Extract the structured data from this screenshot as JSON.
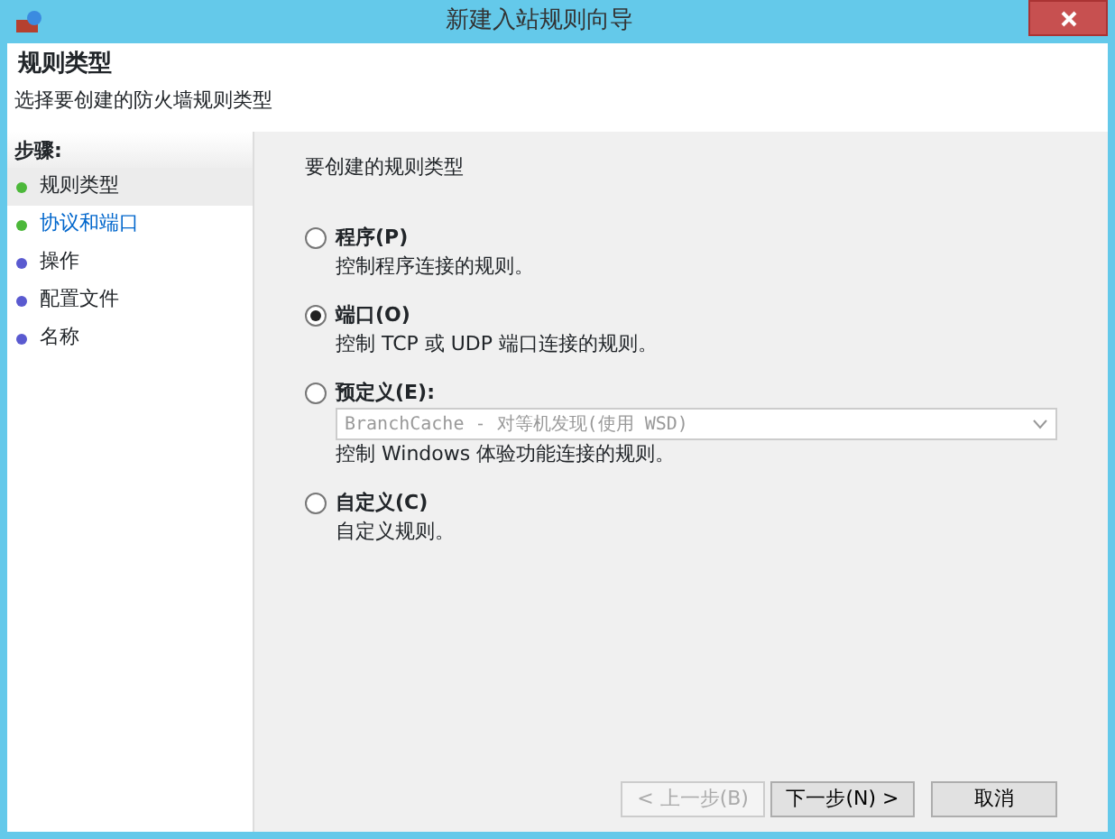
{
  "window": {
    "title": "新建入站规则向导"
  },
  "header": {
    "title": "规则类型",
    "subtitle": "选择要创建的防火墙规则类型"
  },
  "sidebar": {
    "title": "步骤:",
    "items": [
      {
        "label": "规则类型",
        "color": "#4cb83a",
        "selected": true,
        "kind": "step"
      },
      {
        "label": "协议和端口",
        "color": "#4cb83a",
        "selected": false,
        "kind": "link"
      },
      {
        "label": "操作",
        "color": "#5a5ad0",
        "selected": false,
        "kind": "step"
      },
      {
        "label": "配置文件",
        "color": "#5a5ad0",
        "selected": false,
        "kind": "step"
      },
      {
        "label": "名称",
        "color": "#5a5ad0",
        "selected": false,
        "kind": "step"
      }
    ]
  },
  "content": {
    "prompt": "要创建的规则类型",
    "options": [
      {
        "label": "程序(P)",
        "description": "控制程序连接的规则。",
        "selected": false,
        "kind": "radio"
      },
      {
        "label": "端口(O)",
        "description": "控制 TCP 或 UDP 端口连接的规则。",
        "selected": true,
        "kind": "radio"
      },
      {
        "label": "预定义(E):",
        "description": "控制 Windows 体验功能连接的规则。",
        "selected": false,
        "kind": "dropdown",
        "dropdown": {
          "value": "BranchCache - 对等机发现(使用 WSD)",
          "disabled": true
        }
      },
      {
        "label": "自定义(C)",
        "description": "自定义规则。",
        "selected": false,
        "kind": "radio"
      }
    ]
  },
  "buttons": [
    {
      "label": "< 上一步(B)",
      "disabled": true
    },
    {
      "label": "下一步(N) >",
      "disabled": false
    },
    {
      "label": "取消",
      "disabled": false
    }
  ]
}
